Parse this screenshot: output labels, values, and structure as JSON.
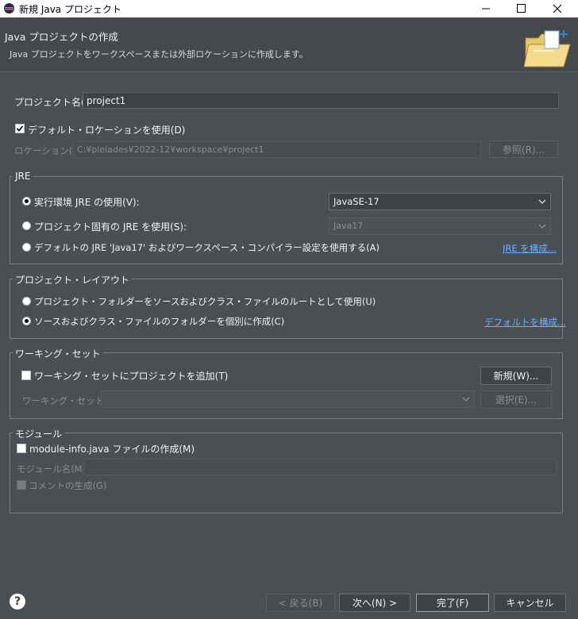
{
  "window": {
    "title": "新規 Java プロジェクト"
  },
  "header": {
    "title": "Java プロジェクトの作成",
    "description": "Java プロジェクトをワークスペースまたは外部ロケーションに作成します。"
  },
  "project": {
    "label": "プロジェクト名(P):",
    "value": "project1"
  },
  "location": {
    "default_label": "デフォルト・ロケーションを使用(D)",
    "default_checked": true,
    "label": "ロケーション(L):",
    "path": "C:¥pleiades¥2022-12¥workspace¥project1",
    "browse_label": "参照(R)..."
  },
  "jre": {
    "group_title": "JRE",
    "option_env": "実行環境 JRE の使用(V):",
    "env_value": "JavaSE-17",
    "option_project": "プロジェクト固有の JRE を使用(S):",
    "project_value": "Java17",
    "option_default": "デフォルトの JRE 'Java17' およびワークスペース・コンパイラー設定を使用する(A)",
    "configure_link": "JRE を構成...",
    "selected": "env"
  },
  "layout": {
    "group_title": "プロジェクト・レイアウト",
    "option_root": "プロジェクト・フォルダーをソースおよびクラス・ファイルのルートとして使用(U)",
    "option_separate": "ソースおよびクラス・ファイルのフォルダーを個別に作成(C)",
    "configure_link": "デフォルトを構成...",
    "selected": "separate"
  },
  "working_set": {
    "group_title": "ワーキング・セット",
    "add_label": "ワーキング・セットにプロジェクトを追加(T)",
    "new_button": "新規(W)...",
    "sets_label": "ワーキング・セット(O):",
    "select_button": "選択(E)..."
  },
  "module": {
    "group_title": "モジュール",
    "create_label": "module-info.java ファイルの作成(M)",
    "name_label": "モジュール名(M):",
    "comment_label": "コメントの生成(G)"
  },
  "footer": {
    "help": "?",
    "back": "< 戻る(B)",
    "next": "次へ(N) >",
    "finish": "完了(F)",
    "cancel": "キャンセル"
  },
  "colors": {
    "accent_link": "#6bb0ff",
    "background": "#4a4f53"
  }
}
